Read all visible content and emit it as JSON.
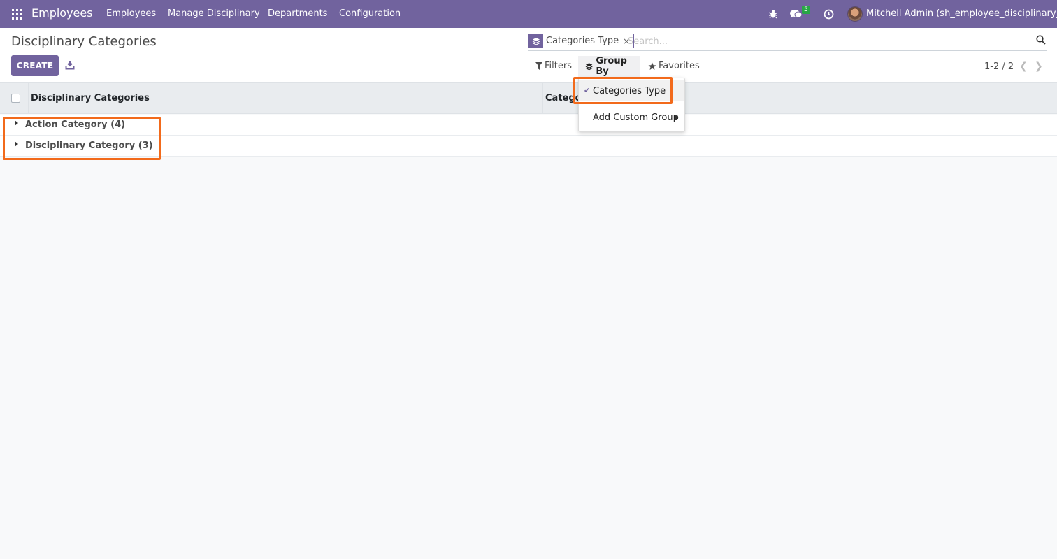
{
  "navbar": {
    "app_name": "Employees",
    "menus": [
      "Employees",
      "Manage Disciplinary",
      "Departments",
      "Configuration"
    ],
    "messages_badge": "5",
    "user_name": "Mitchell Admin (sh_employee_disciplinary__)",
    "icons": {
      "apps": "apps-grid-icon",
      "debug": "bug-icon",
      "messages": "chat-icon",
      "activities": "clock-icon"
    }
  },
  "control_panel": {
    "title": "Disciplinary Categories",
    "create_label": "CREATE",
    "download_icon": "download-icon",
    "search": {
      "facet_label": "Categories Type",
      "facet_close": "×",
      "placeholder": "Search..."
    },
    "filters_label": "Filters",
    "group_by_label": "Group By",
    "favorites_label": "Favorites",
    "pager": "1-2 / 2"
  },
  "list": {
    "columns": [
      "Disciplinary Categories",
      "Categor"
    ],
    "groups": [
      {
        "label": "Action Category (4)"
      },
      {
        "label": "Disciplinary Category (3)"
      }
    ]
  },
  "group_by_dropdown": {
    "items": [
      {
        "label": "Categories Type",
        "checked": true
      },
      {
        "label": "Add Custom Group",
        "submenu": true
      }
    ]
  },
  "colors": {
    "brand": "#71639e",
    "highlight": "#f26a1b",
    "badge": "#28a745"
  }
}
